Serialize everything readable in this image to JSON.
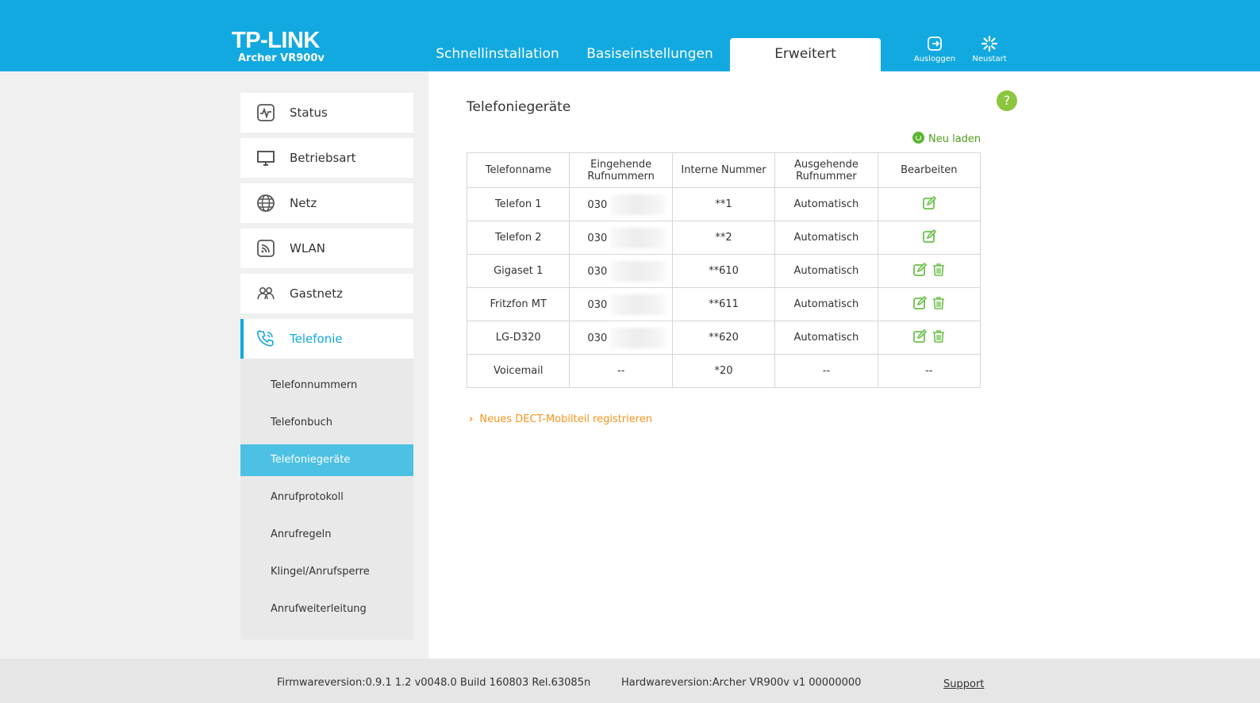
{
  "header": {
    "logo": "TP-LINK",
    "model": "Archer VR900v",
    "tabs": [
      {
        "label": "Schnellinstallation"
      },
      {
        "label": "Basiseinstellungen"
      },
      {
        "label": "Erweitert"
      }
    ],
    "logout_label": "Ausloggen",
    "reboot_label": "Neustart"
  },
  "sidebar": {
    "items": [
      {
        "label": "Status",
        "icon": "status-icon"
      },
      {
        "label": "Betriebsart",
        "icon": "monitor-icon"
      },
      {
        "label": "Netz",
        "icon": "globe-icon"
      },
      {
        "label": "WLAN",
        "icon": "wifi-icon"
      },
      {
        "label": "Gastnetz",
        "icon": "guests-icon"
      },
      {
        "label": "Telefonie",
        "icon": "phone-icon"
      }
    ],
    "sub_items": [
      {
        "label": "Telefonnummern"
      },
      {
        "label": "Telefonbuch"
      },
      {
        "label": "Telefoniegeräte"
      },
      {
        "label": "Anrufprotokoll"
      },
      {
        "label": "Anrufregeln"
      },
      {
        "label": "Klingel/Anrufsperre"
      },
      {
        "label": "Anrufweiterleitung"
      }
    ]
  },
  "main": {
    "title": "Telefoniegeräte",
    "help": "?",
    "reload_label": "Neu laden",
    "table": {
      "headers": {
        "name": "Telefonname",
        "incoming_1": "Eingehende",
        "incoming_2": "Rufnummern",
        "internal": "Interne Nummer",
        "outgoing_1": "Ausgehende",
        "outgoing_2": "Rufnummer",
        "edit": "Bearbeiten"
      },
      "rows": [
        {
          "name": "Telefon 1",
          "incoming": "030",
          "internal": "**1",
          "outgoing": "Automatisch"
        },
        {
          "name": "Telefon 2",
          "incoming": "030",
          "internal": "**2",
          "outgoing": "Automatisch"
        },
        {
          "name": "Gigaset 1",
          "incoming": "030",
          "internal": "**610",
          "outgoing": "Automatisch"
        },
        {
          "name": "Fritzfon MT",
          "incoming": "030",
          "internal": "**611",
          "outgoing": "Automatisch"
        },
        {
          "name": "LG-D320",
          "incoming": "030",
          "internal": "**620",
          "outgoing": "Automatisch"
        },
        {
          "name": "Voicemail",
          "incoming": "--",
          "internal": "*20",
          "outgoing": "--",
          "edit": "--"
        }
      ]
    },
    "dect_link": "Neues DECT-Mobilteil registrieren"
  },
  "footer": {
    "firmware": "Firmwareversion:0.9.1 1.2 v0048.0 Build 160803 Rel.63085n",
    "hardware": "Hardwareversion:Archer VR900v v1 00000000",
    "support": "Support"
  },
  "colors": {
    "header_blue": "#12a9e0",
    "active_sub": "#4cc1e4",
    "green": "#8cc63f",
    "orange": "#f7941d"
  }
}
